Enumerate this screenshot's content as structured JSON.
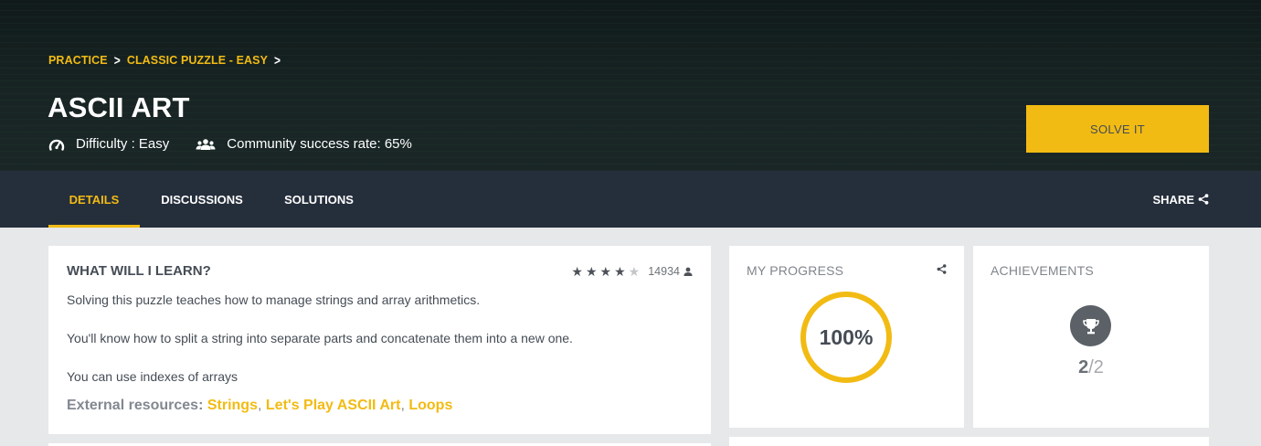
{
  "breadcrumb": {
    "items": [
      "PRACTICE",
      "CLASSIC PUZZLE - EASY"
    ]
  },
  "puzzle": {
    "title": "ASCII ART",
    "difficulty": "Difficulty : Easy",
    "success_rate": "Community success rate: 65%"
  },
  "solve_button": {
    "label": "SOLVE IT"
  },
  "tabs": [
    {
      "label": "DETAILS",
      "active": true
    },
    {
      "label": "DISCUSSIONS",
      "active": false
    },
    {
      "label": "SOLUTIONS",
      "active": false
    }
  ],
  "share": {
    "label": "SHARE"
  },
  "learn": {
    "heading": "WHAT WILL I LEARN?",
    "rating": {
      "stars": 4,
      "max_stars": 5,
      "count": "14934"
    },
    "paragraphs": [
      "Solving this puzzle teaches how to manage strings and array arithmetics.",
      "You'll know how to split a string into separate parts and concatenate them into a new one.",
      "You can use indexes of arrays"
    ],
    "resources_label": "External resources:",
    "resources": [
      "Strings",
      "Let's Play ASCII Art",
      "Loops"
    ]
  },
  "progress": {
    "title": "MY PROGRESS",
    "percent": 100,
    "percent_label": "100%"
  },
  "achievements": {
    "title": "ACHIEVEMENTS",
    "earned": "2",
    "total": "/2"
  },
  "colors": {
    "accent": "#f2bb13",
    "tabbar": "#252e3b",
    "text": "#454c55",
    "page_bg": "#e7e8e9"
  }
}
